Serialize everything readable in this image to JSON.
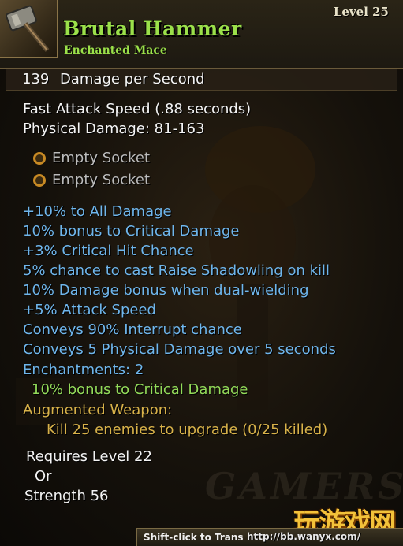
{
  "item": {
    "name": "Brutal Hammer",
    "type": "Enchanted Mace",
    "level": "Level 25",
    "icon": "hammer-icon"
  },
  "stats": {
    "dps_value": "139",
    "dps_label": "Damage per Second",
    "attack_speed": "Fast Attack Speed (.88 seconds)",
    "physical_damage": "Physical Damage: 81-163"
  },
  "sockets": [
    "Empty Socket",
    "Empty Socket"
  ],
  "properties": [
    "+10% to All Damage",
    "10% bonus to Critical Damage",
    "+3% Critical Hit Chance",
    "5% chance to cast Raise Shadowling on kill",
    "10% Damage bonus when dual-wielding",
    "+5% Attack Speed",
    "Conveys 90% Interrupt chance",
    "Conveys 5 Physical Damage over 5 seconds"
  ],
  "enchantments": {
    "label": "Enchantments: 2",
    "items": [
      "10% bonus to Critical Damage"
    ]
  },
  "augmented": {
    "label": "Augmented Weapon:",
    "requirement": "Kill 25 enemies to upgrade (0/25 killed)"
  },
  "requirements": {
    "line1": "Requires Level 22",
    "line2": "Or",
    "line3": "Strength 56"
  },
  "footer": {
    "hint": "Shift-click to Trans",
    "url": "http://bb.wanyx.com/"
  },
  "overlay": {
    "watermark": "GAMERSKY",
    "logo": "玩游戏网"
  },
  "colors": {
    "title": "#9be04a",
    "property": "#6fb6ec",
    "augmented": "#d8b24a",
    "socket": "#c88a24"
  }
}
